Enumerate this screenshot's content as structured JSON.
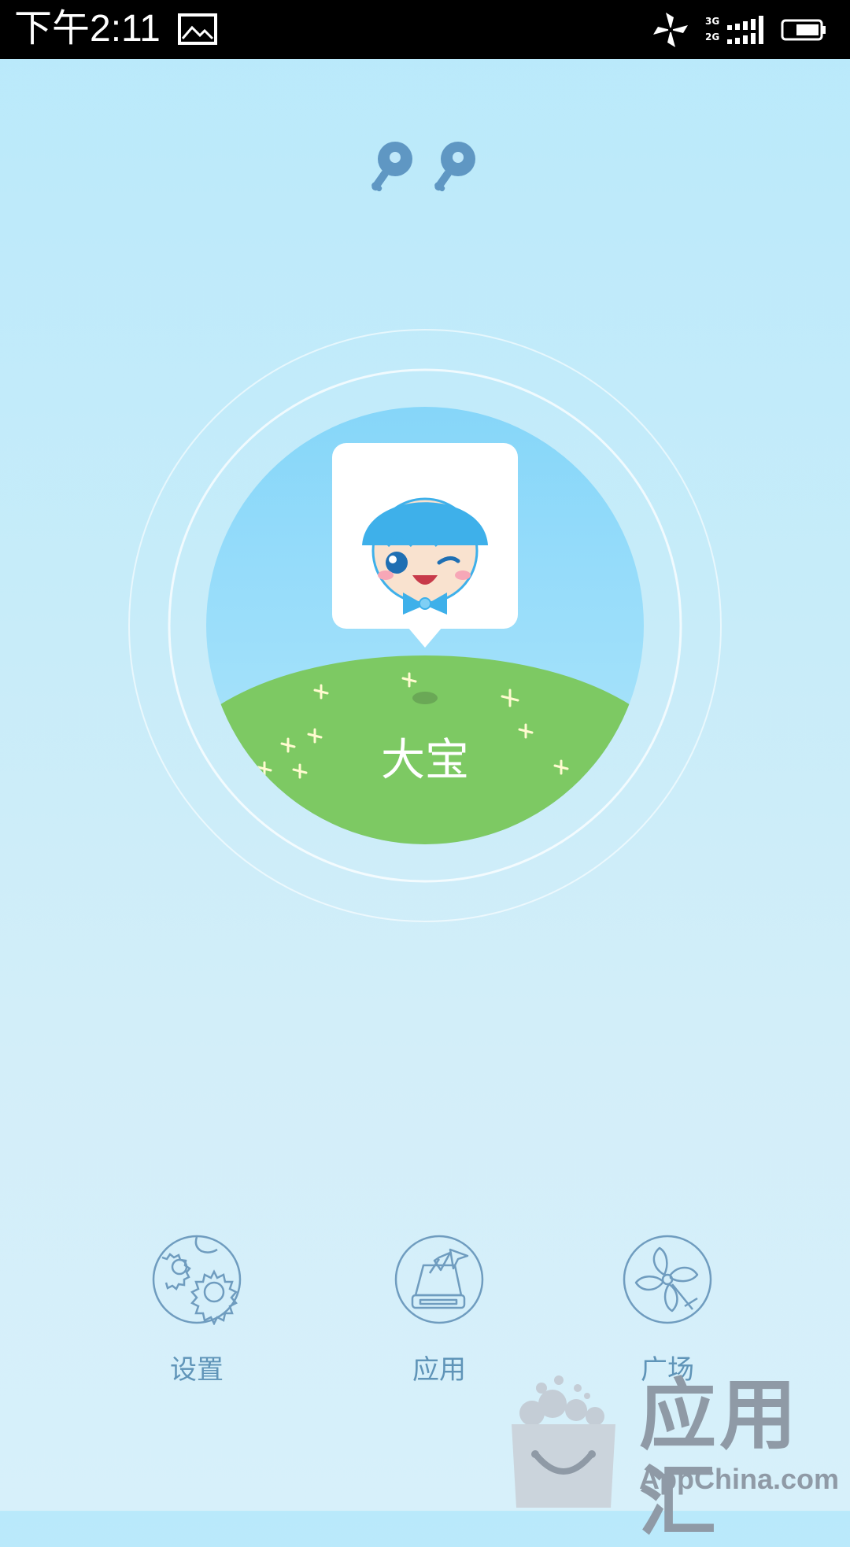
{
  "status_bar": {
    "time": "下午2:11",
    "network": "3G\n2G",
    "icons": [
      "image-icon",
      "pinwheel-icon",
      "signal-icon",
      "battery-icon"
    ]
  },
  "header": {
    "icons": [
      "key-icon",
      "key-icon"
    ]
  },
  "profile": {
    "name": "大宝",
    "avatar": "boy-avatar-icon"
  },
  "nav": {
    "settings_label": "设置",
    "apps_label": "应用",
    "plaza_label": "广场"
  },
  "watermark": {
    "cn": "应用汇",
    "en": "AppChina.com"
  },
  "colors": {
    "bg_top": "#b9e9fb",
    "bg_bottom": "#d7f0fa",
    "hill_green": "#7dc963",
    "nav_stroke": "#6f9cbf",
    "key_color": "#5f97c3"
  }
}
